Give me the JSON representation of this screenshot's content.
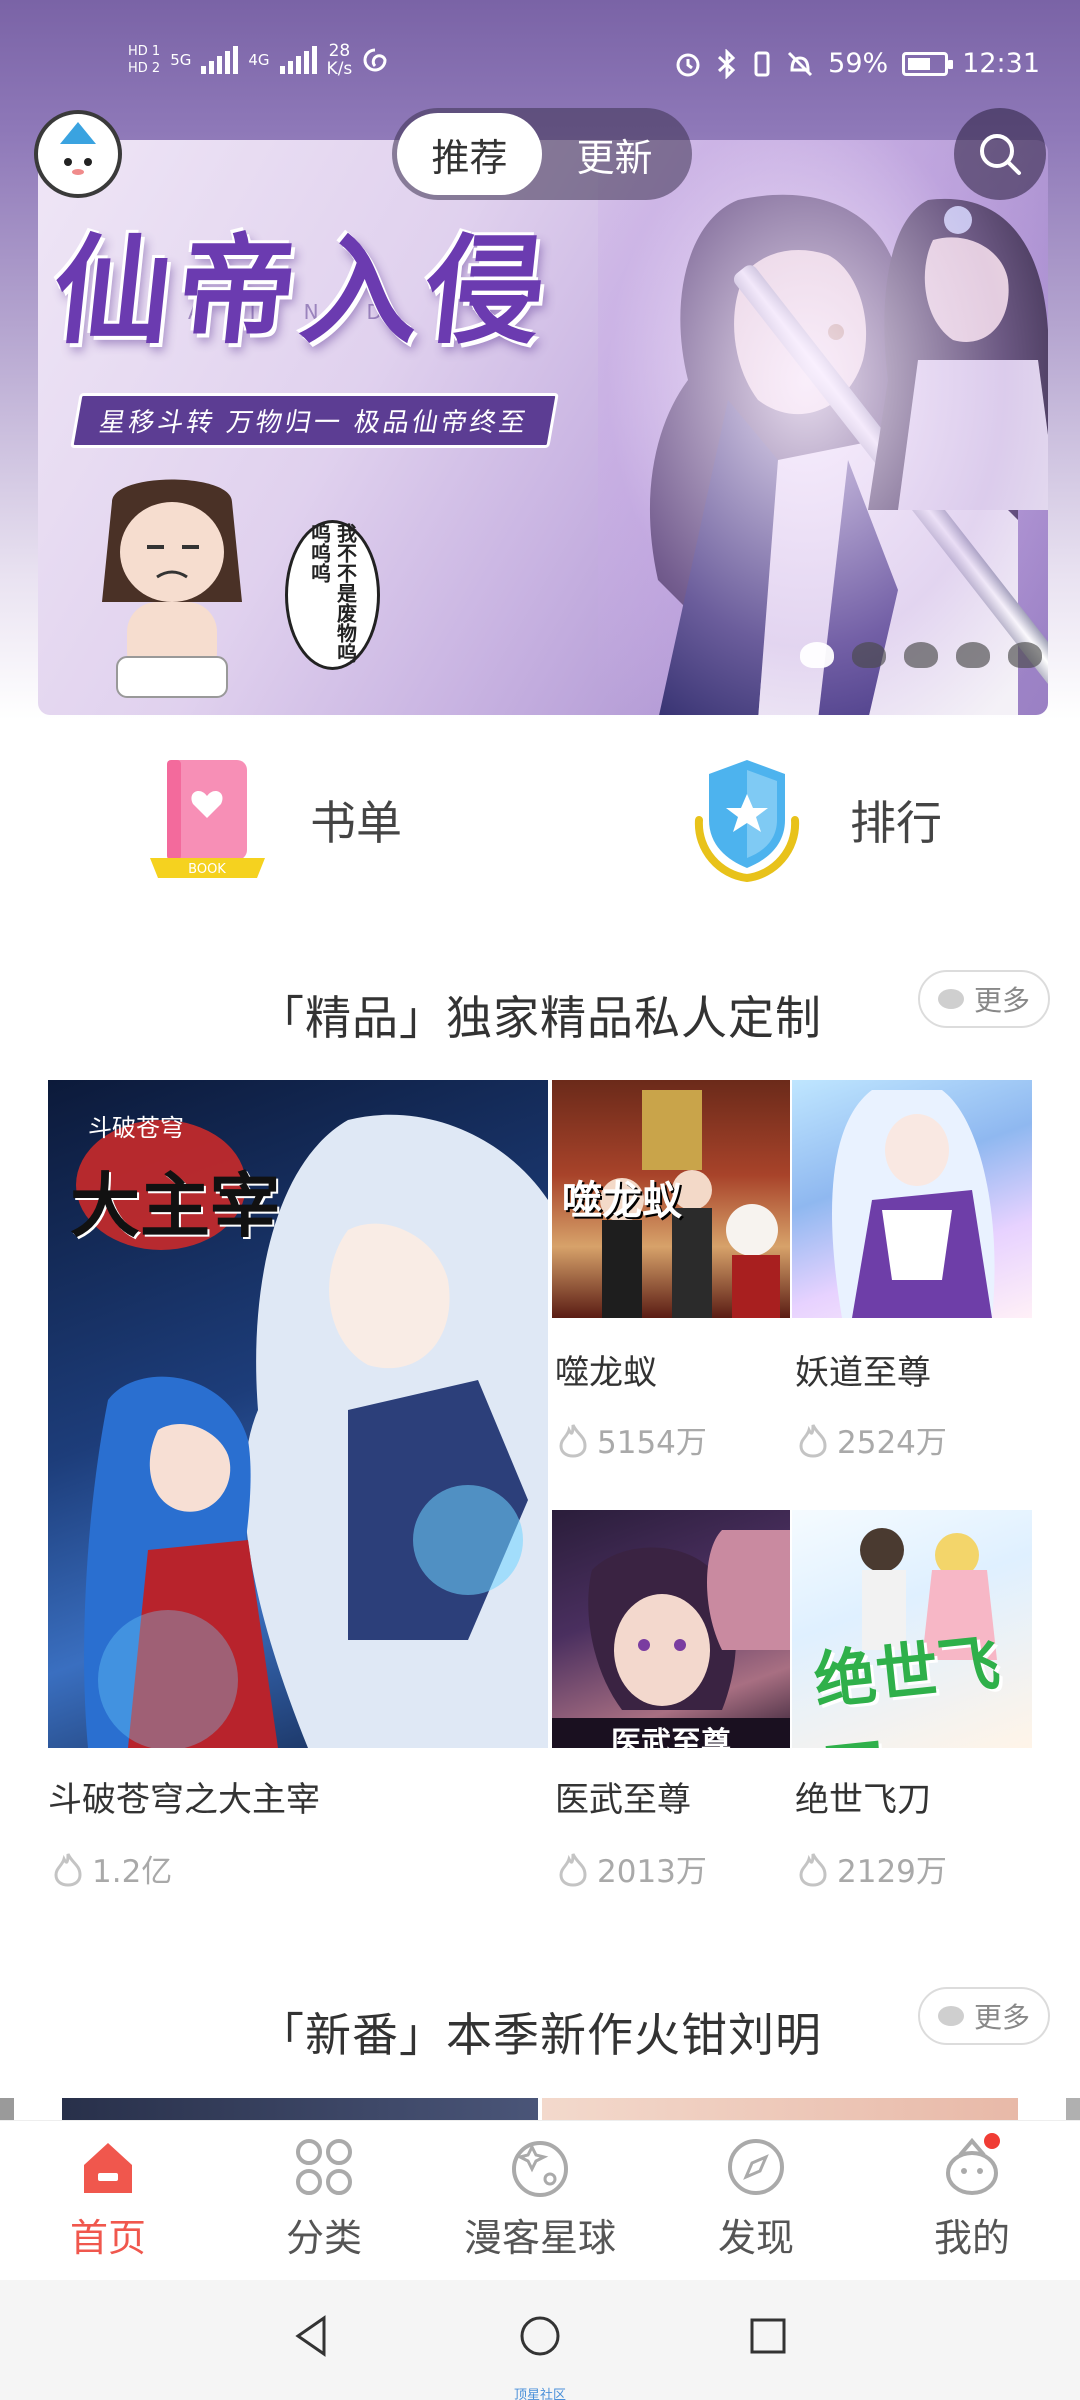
{
  "status_bar": {
    "hd1": "HD 1",
    "hd2": "HD 2",
    "net1": "5G",
    "net2": "4G",
    "speed_value": "28",
    "speed_unit": "K/s",
    "battery_pct": "59%",
    "time": "12:31"
  },
  "header": {
    "tabs": [
      {
        "label": "推荐",
        "active": true
      },
      {
        "label": "更新",
        "active": false
      }
    ]
  },
  "banner": {
    "title_art": "仙帝入侵",
    "subtitle": "星移斗转 万物归一 极品仙帝终至",
    "deco_letters": "AIND",
    "speech_bubble": "我不不是废物呜呜呜呜",
    "page_count": 5,
    "active_page": 1
  },
  "quick_entries": [
    {
      "label": "书单",
      "icon": "booklist-icon",
      "badge": "BOOK"
    },
    {
      "label": "排行",
      "icon": "ranking-shield-icon"
    }
  ],
  "section_premium": {
    "title": "「精品」独家精品私人定制",
    "more_label": "更多",
    "featured": {
      "name": "斗破苍穹之大主宰",
      "hot": "1.2亿",
      "cover_text": "大主宰",
      "cover_small_text": "斗破苍穹"
    },
    "items": [
      {
        "name": "噬龙蚁",
        "hot": "5154万",
        "cover_text": "噬龙蚁"
      },
      {
        "name": "妖道至尊",
        "hot": "2524万"
      },
      {
        "name": "医武至尊",
        "hot": "2013万",
        "cover_text": "医武至尊"
      },
      {
        "name": "绝世飞刀",
        "hot": "2129万",
        "cover_text": "绝世飞刀"
      }
    ]
  },
  "section_new": {
    "title": "「新番」本季新作火钳刘明",
    "more_label": "更多"
  },
  "bottom_nav": [
    {
      "label": "首页",
      "icon": "home-icon",
      "active": true
    },
    {
      "label": "分类",
      "icon": "category-icon",
      "active": false
    },
    {
      "label": "漫客星球",
      "icon": "planet-icon",
      "active": false
    },
    {
      "label": "发现",
      "icon": "compass-icon",
      "active": false
    },
    {
      "label": "我的",
      "icon": "profile-icon",
      "active": false,
      "has_dot": true
    }
  ],
  "system_nav": {
    "watermark": "顶星社区"
  },
  "colors": {
    "accent": "#f0574d",
    "hero_purple": "#6b3bb0",
    "muted": "#a9a9a9"
  }
}
